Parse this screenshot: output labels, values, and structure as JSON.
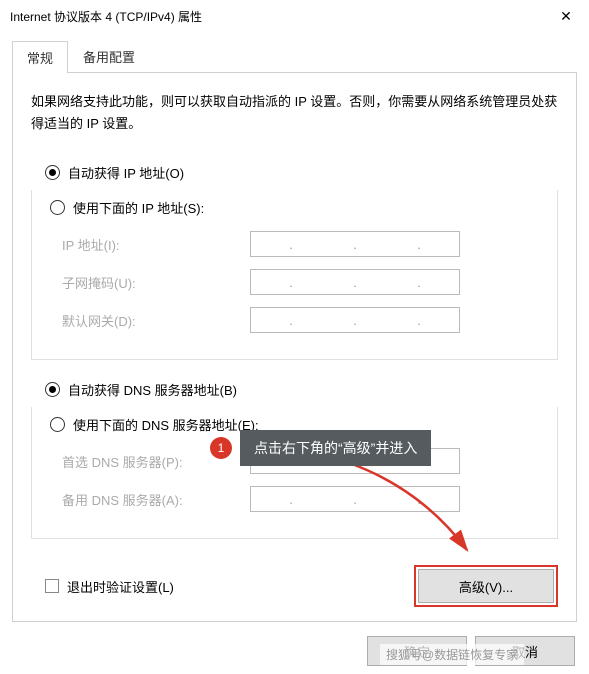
{
  "title": "Internet 协议版本 4 (TCP/IPv4) 属性",
  "tabs": {
    "general": "常规",
    "alternate": "备用配置"
  },
  "intro": "如果网络支持此功能，则可以获取自动指派的 IP 设置。否则，你需要从网络系统管理员处获得适当的 IP 设置。",
  "ip": {
    "auto": "自动获得 IP 地址(O)",
    "manual": "使用下面的 IP 地址(S):",
    "addr": "IP 地址(I):",
    "mask": "子网掩码(U):",
    "gateway": "默认网关(D):"
  },
  "dns": {
    "auto": "自动获得 DNS 服务器地址(B)",
    "manual": "使用下面的 DNS 服务器地址(E):",
    "preferred": "首选 DNS 服务器(P):",
    "alternate": "备用 DNS 服务器(A):"
  },
  "validate": "退出时验证设置(L)",
  "advanced": "高级(V)...",
  "ok": "确定",
  "cancel": "取消",
  "annotation": {
    "num": "1",
    "text": "点击右下角的“高级”并进入"
  },
  "watermark": "搜狐号@数据链恢复专家"
}
